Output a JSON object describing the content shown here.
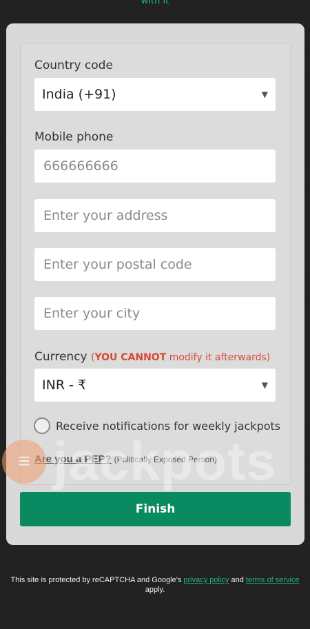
{
  "top_text": "with it",
  "form": {
    "country_label": "Country code",
    "country_value": "India (+91)",
    "phone_label": "Mobile phone",
    "phone_placeholder": "666666666",
    "address_placeholder": "Enter your address",
    "postal_placeholder": "Enter your postal code",
    "city_placeholder": "Enter your city",
    "currency_label": "Currency",
    "currency_warning_open": "(",
    "currency_warning_bold": "YOU CANNOT",
    "currency_warning_rest": " modify it afterwards)",
    "currency_value": "INR - ₹",
    "notifications_label": "Receive notifications for weekly jackpots",
    "pep_link": "Are you a PEP?",
    "pep_sub": "(Politically Exposed Person)",
    "finish_label": "Finish"
  },
  "watermark": {
    "logo_glyph": "≡",
    "text": "jackpots"
  },
  "footer": {
    "text1": "This site is protected by reCAPTCHA and Google's ",
    "privacy": "privacy policy",
    "and": " and ",
    "terms": "terms of service",
    "apply": " apply."
  },
  "colors": {
    "accent": "#0a8a61",
    "link": "#1eb980",
    "warning": "#d64a33"
  }
}
